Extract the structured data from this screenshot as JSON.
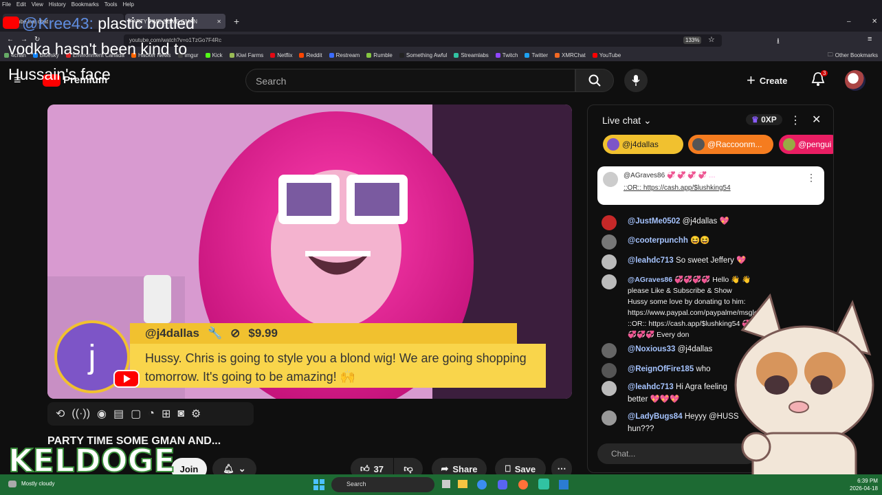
{
  "browser": {
    "menu": [
      "File",
      "Edit",
      "View",
      "History",
      "Bookmarks",
      "Tools",
      "Help"
    ],
    "tabs": [
      {
        "label": "youtube live chat"
      },
      {
        "label": "PARTY TIME SOME GMAN"
      }
    ],
    "url": "youtube.com/watch?v=o1TzGo7F4Rc",
    "zoom": "133%",
    "bookmarks": [
      "4chan",
      "Bluesky",
      "Environment Canada",
      "Hacker News",
      "imgur",
      "Kick",
      "Kiwi Farms",
      "Netflix",
      "Reddit",
      "Restream",
      "Rumble",
      "Something Awful",
      "Streamlabs",
      "Twitch",
      "Twitter",
      "XMRChat",
      "YouTube"
    ],
    "other_bookmarks": "Other Bookmarks"
  },
  "overlay": {
    "subtitle_user": "@Kree43:",
    "subtitle_text": "plastic bottled vodka hasn't been kind to Hussain's face",
    "streamer_logo": "KELDOGE"
  },
  "yt": {
    "logo": "Premium",
    "search_placeholder": "Search",
    "create_label": "Create",
    "notif_count": "3"
  },
  "video": {
    "superchat_user": "@j4dallas",
    "superchat_amount": "$9.99",
    "superchat_avatar_letter": "j",
    "superchat_message": "Hussy. Chris is going to style you a blond wig! We are going shopping tomorrow. It's going to be amazing! 🙌",
    "title": "PARTY TIME SOME GMAN AND...",
    "join_label": "Join",
    "like_count": "37",
    "share_label": "Share",
    "save_label": "Save"
  },
  "chat": {
    "header": "Live chat",
    "xp": "0XP",
    "chips": [
      "@j4dallas",
      "@Raccoonm...",
      "@pengui"
    ],
    "pinned_user": "@AGraves86",
    "pinned_line2": "::OR:: https://cash.app/$lushking54",
    "messages": [
      {
        "author": "@JustMe0502",
        "text": "@j4dallas 💖"
      },
      {
        "author": "@cooterpunchh",
        "text": "😆😆"
      },
      {
        "author": "@leahdc713",
        "text": "So sweet Jeffery 💖"
      },
      {
        "author": "@AGraves86",
        "text": "💞💞💞💞 Hello 👋 👋 please Like & Subscribe & Show Hussy some love by donating to him: https://www.paypal.com/paypalme/msglorie ::OR:: https://cash.app/$lushking54 💞💞💞💞 Every don"
      },
      {
        "author": "@Noxious33",
        "text": "@j4dallas"
      },
      {
        "author": "@ReignOfFire185",
        "text": "who"
      },
      {
        "author": "@leahdc713",
        "text": "Hi Agra feeling better 💖💖💖"
      },
      {
        "author": "@LadyBugs84",
        "text": "Heyyy @HUSS hun???"
      }
    ],
    "input_placeholder": "Chat..."
  },
  "taskbar": {
    "weather": "Mostly cloudy",
    "search": "Search",
    "time": "6:39 PM",
    "date": "2026-04-18"
  }
}
